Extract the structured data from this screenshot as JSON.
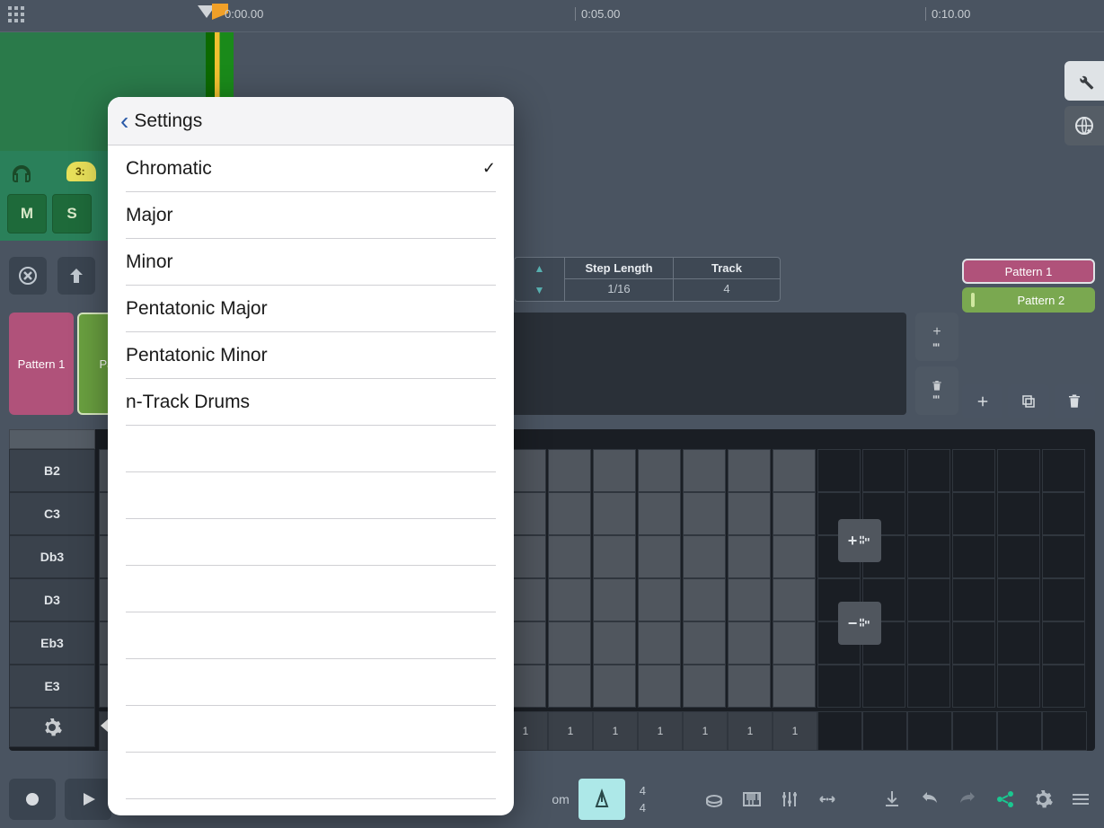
{
  "timeline": {
    "t1": "0:00.00",
    "t2": "0:05.00",
    "t3": "0:10.00"
  },
  "track": {
    "badge": "3:",
    "mute": "M",
    "solo": "S"
  },
  "step": {
    "lenlabel": "Step Length",
    "tracklabel": "Track",
    "lenval": "1/16",
    "trackval": "4"
  },
  "patterns": {
    "p1": "Pattern 1",
    "p2": "Patt"
  },
  "patlist": {
    "p1": "Pattern 1",
    "p2": "Pattern 2"
  },
  "notes": [
    "B2",
    "C3",
    "Db3",
    "D3",
    "Eb3",
    "E3"
  ],
  "gridnums": [
    "1",
    "1",
    "1",
    "1",
    "1",
    "1",
    "1"
  ],
  "bottom": {
    "bpm": "om",
    "metroval1": "4",
    "metroval2": "4"
  },
  "popover": {
    "title": "Settings",
    "items": [
      {
        "label": "Chromatic",
        "selected": true
      },
      {
        "label": "Major",
        "selected": false
      },
      {
        "label": "Minor",
        "selected": false
      },
      {
        "label": "Pentatonic Major",
        "selected": false
      },
      {
        "label": "Pentatonic Minor",
        "selected": false
      },
      {
        "label": "n-Track Drums",
        "selected": false
      }
    ]
  }
}
